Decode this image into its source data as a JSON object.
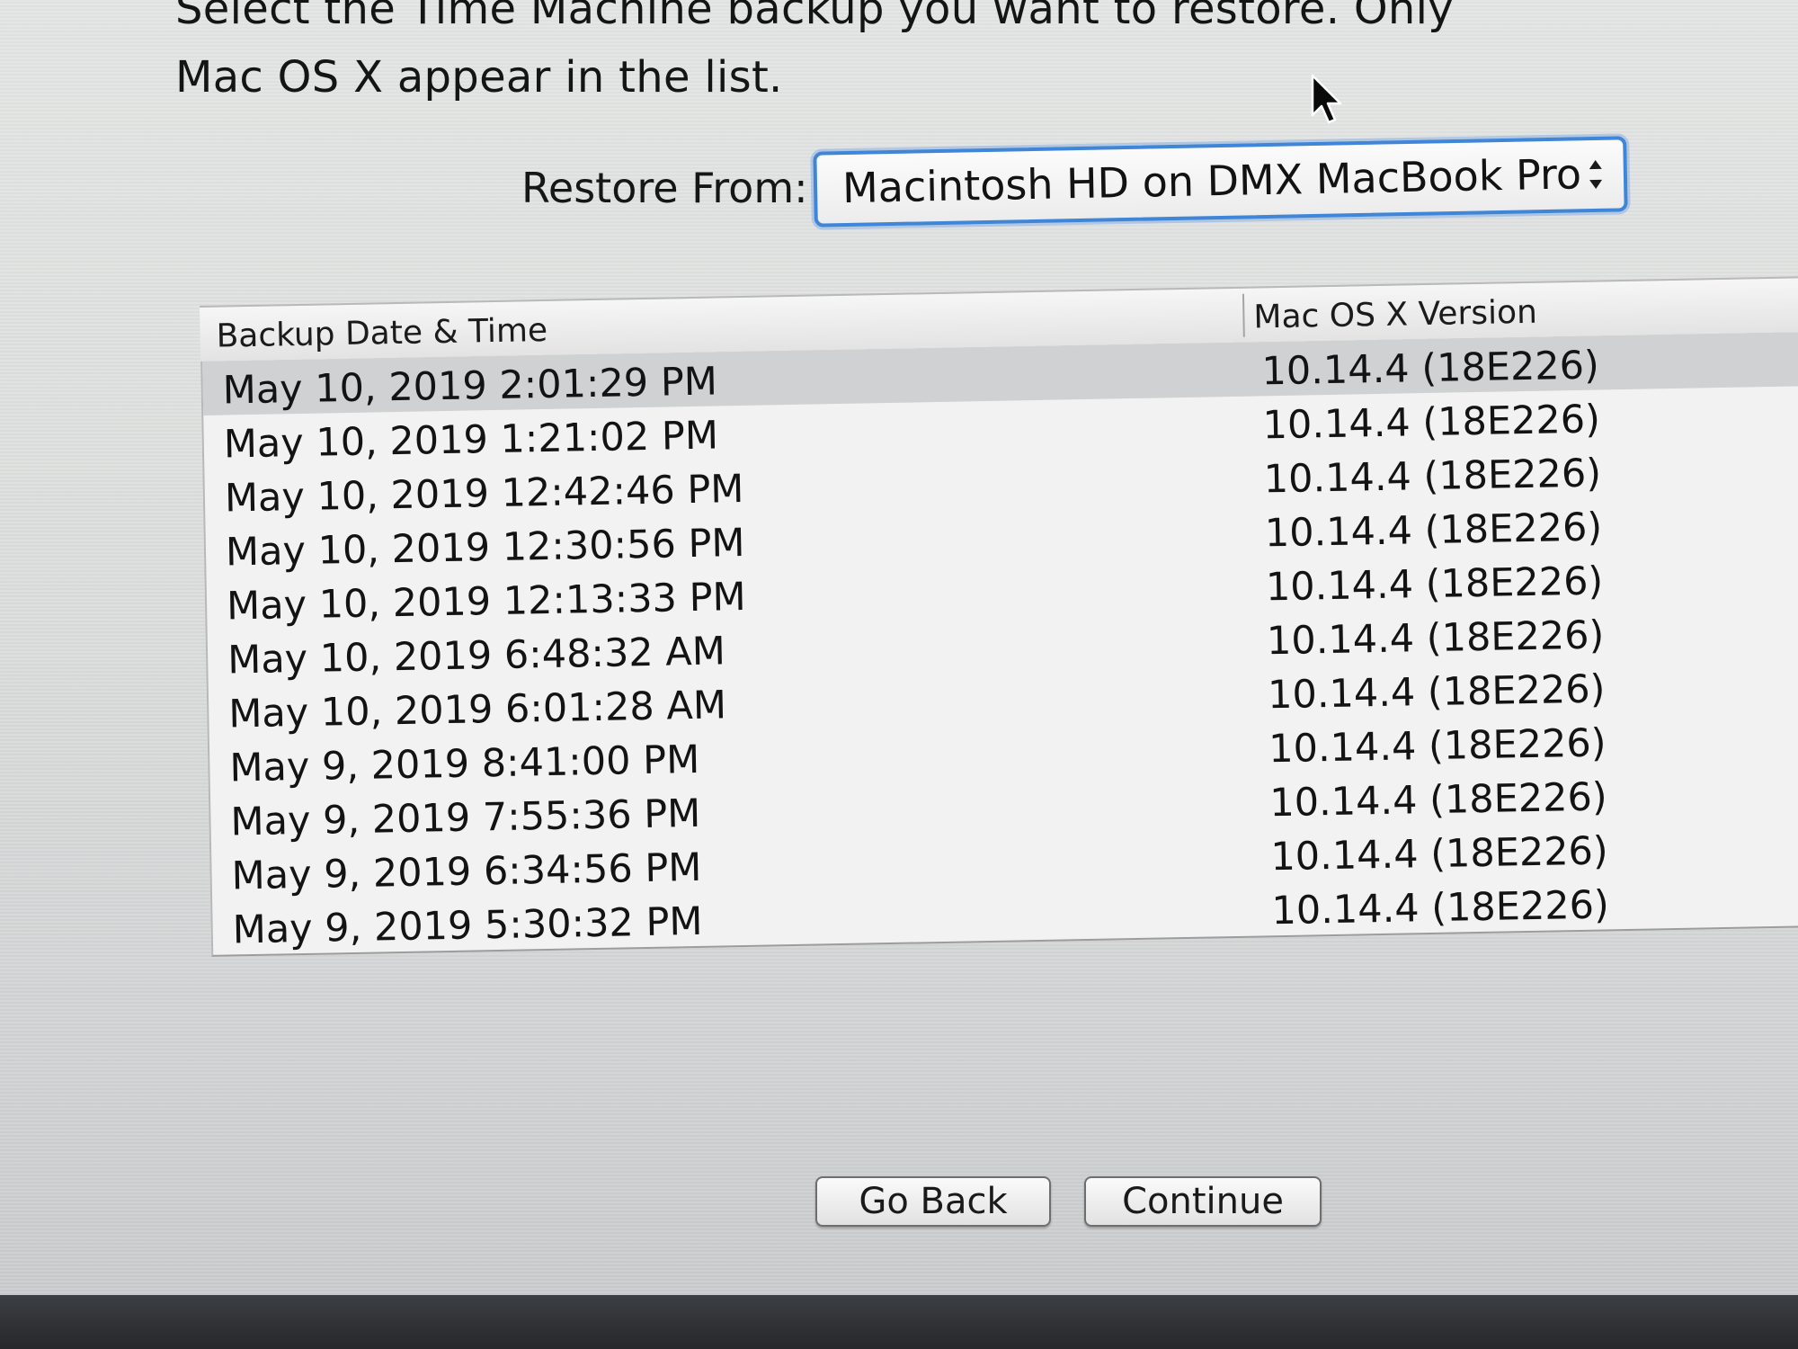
{
  "instruction": {
    "line1": "Select the Time Machine backup you want to restore. Only",
    "line2": "Mac OS X appear in the list."
  },
  "restore": {
    "label": "Restore From:",
    "selected": "Macintosh HD on DMX MacBook Pro"
  },
  "table": {
    "columns": {
      "date": "Backup Date & Time",
      "version": "Mac OS X Version"
    },
    "rows": [
      {
        "date": "May 10, 2019 2:01:29 PM",
        "version": "10.14.4 (18E226)"
      },
      {
        "date": "May 10, 2019 1:21:02 PM",
        "version": "10.14.4 (18E226)"
      },
      {
        "date": "May 10, 2019 12:42:46 PM",
        "version": "10.14.4 (18E226)"
      },
      {
        "date": "May 10, 2019 12:30:56 PM",
        "version": "10.14.4 (18E226)"
      },
      {
        "date": "May 10, 2019 12:13:33 PM",
        "version": "10.14.4 (18E226)"
      },
      {
        "date": "May 10, 2019 6:48:32 AM",
        "version": "10.14.4 (18E226)"
      },
      {
        "date": "May 10, 2019 6:01:28 AM",
        "version": "10.14.4 (18E226)"
      },
      {
        "date": "May 9, 2019 8:41:00 PM",
        "version": "10.14.4 (18E226)"
      },
      {
        "date": "May 9, 2019 7:55:36 PM",
        "version": "10.14.4 (18E226)"
      },
      {
        "date": "May 9, 2019 6:34:56 PM",
        "version": "10.14.4 (18E226)"
      },
      {
        "date": "May 9, 2019 5:30:32 PM",
        "version": "10.14.4 (18E226)"
      }
    ]
  },
  "buttons": {
    "back": "Go Back",
    "continue": "Continue"
  },
  "icons": {
    "cursor": "arrow-cursor-icon",
    "popup": "up-down-chevron-icon"
  },
  "colors": {
    "focus_ring": "#3f86d8",
    "selected_row": "#cfd1d2"
  }
}
